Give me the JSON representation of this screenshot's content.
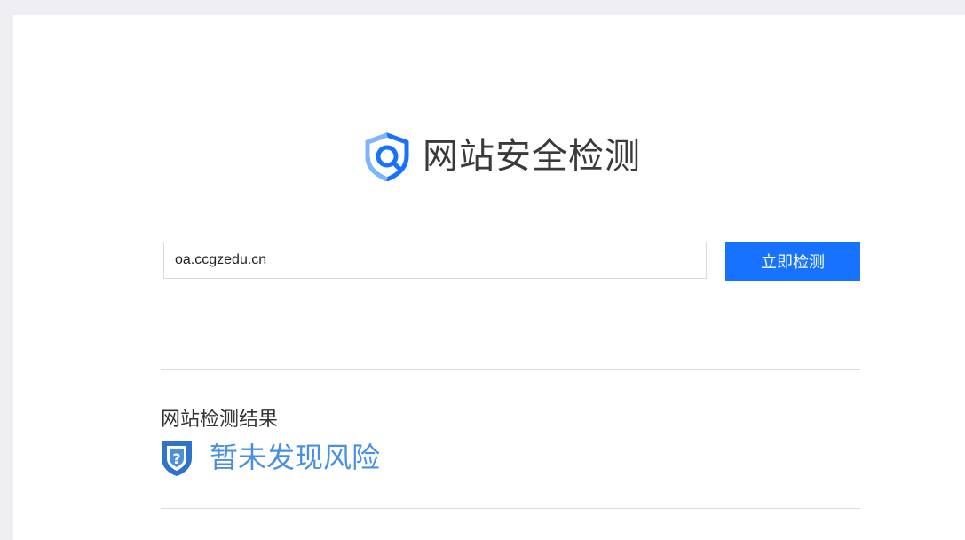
{
  "header": {
    "title": "网站安全检测",
    "logo_icon": "shield-search-icon",
    "logo_color": "#1773ff"
  },
  "search": {
    "value": "oa.ccgzedu.cn",
    "placeholder": "",
    "button_label": "立即检测",
    "button_color": "#1773ff"
  },
  "result": {
    "heading": "网站检测结果",
    "status": "暂未发现风险",
    "status_icon": "shield-question-icon",
    "status_color": "#4a90e2"
  }
}
